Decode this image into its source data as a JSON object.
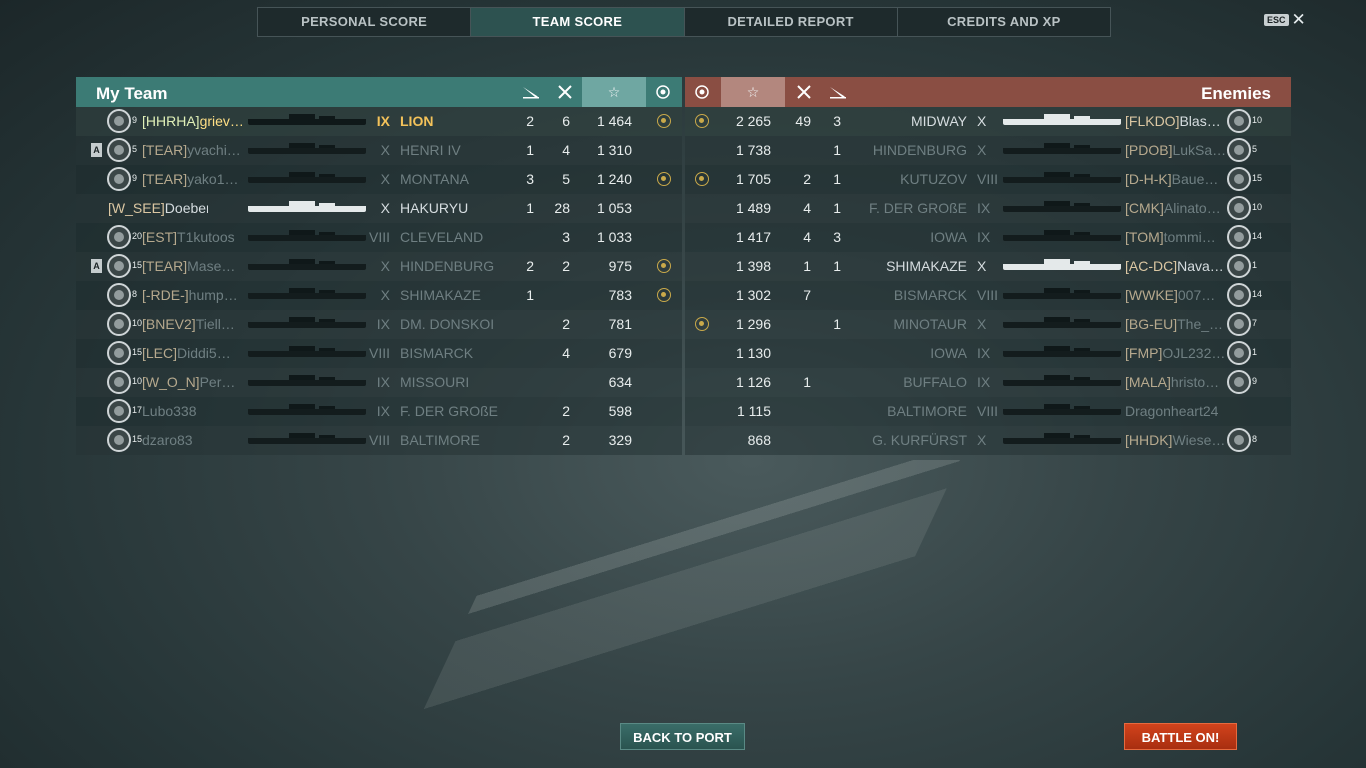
{
  "tabs": [
    "PERSONAL SCORE",
    "TEAM SCORE",
    "DETAILED REPORT",
    "CREDITS AND XP"
  ],
  "esc": {
    "key": "ESC",
    "close": "✕"
  },
  "my_team": {
    "title": "My Team",
    "headers": {
      "torpedo_icon": "torpedo-icon",
      "kills_icon": "crossed-swords-icon",
      "star": "☆",
      "medal_icon": "medal-icon"
    },
    "rows": [
      {
        "rank": "9",
        "clan": "[HHRHA]",
        "name": "griev…",
        "tier": "IX",
        "ship": "LION",
        "c1": "2",
        "c2": "6",
        "score": "1 464",
        "medal": true,
        "state": "me",
        "div": ""
      },
      {
        "rank": "5",
        "clan": "[TEAR]",
        "name": "yvachi…",
        "tier": "X",
        "ship": "HENRI IV",
        "c1": "1",
        "c2": "4",
        "score": "1 310",
        "medal": false,
        "state": "dead",
        "div": "A"
      },
      {
        "rank": "9",
        "clan": "[TEAR]",
        "name": "yako1…",
        "tier": "X",
        "ship": "MONTANA",
        "c1": "3",
        "c2": "5",
        "score": "1 240",
        "medal": true,
        "state": "dead",
        "div": ""
      },
      {
        "rank": "",
        "clan": "[W_SEE]",
        "name": "Doebernitz",
        "tier": "X",
        "ship": "HAKURYU",
        "c1": "1",
        "c2": "28",
        "score": "1 053",
        "medal": false,
        "state": "alive",
        "div": ""
      },
      {
        "rank": "20",
        "clan": "[EST]",
        "name": "T1kutoos",
        "tier": "VIII",
        "ship": "CLEVELAND",
        "c1": "",
        "c2": "3",
        "score": "1 033",
        "medal": false,
        "state": "dead",
        "div": ""
      },
      {
        "rank": "15",
        "clan": "[TEAR]",
        "name": "Mase…",
        "tier": "X",
        "ship": "HINDENBURG",
        "c1": "2",
        "c2": "2",
        "score": "975",
        "medal": true,
        "state": "dead",
        "div": "A"
      },
      {
        "rank": "8",
        "clan": "[-RDE-]",
        "name": "hump…",
        "tier": "X",
        "ship": "SHIMAKAZE",
        "c1": "1",
        "c2": "",
        "score": "783",
        "medal": true,
        "state": "dead",
        "div": ""
      },
      {
        "rank": "10",
        "clan": "[BNEV2]",
        "name": "Tiell…",
        "tier": "IX",
        "ship": "DM. DONSKOI",
        "c1": "",
        "c2": "2",
        "score": "781",
        "medal": false,
        "state": "dead",
        "div": ""
      },
      {
        "rank": "15",
        "clan": "[LEC]",
        "name": "Diddi5…",
        "tier": "VIII",
        "ship": "BISMARCK",
        "c1": "",
        "c2": "4",
        "score": "679",
        "medal": false,
        "state": "dead",
        "div": ""
      },
      {
        "rank": "10",
        "clan": "[W_O_N]",
        "name": "Per…",
        "tier": "IX",
        "ship": "MISSOURI",
        "c1": "",
        "c2": "",
        "score": "634",
        "medal": false,
        "state": "dead",
        "div": ""
      },
      {
        "rank": "17",
        "clan": "",
        "name": "Lubo338",
        "tier": "IX",
        "ship": "F. DER GROßE",
        "c1": "",
        "c2": "2",
        "score": "598",
        "medal": false,
        "state": "dead",
        "div": ""
      },
      {
        "rank": "15",
        "clan": "",
        "name": "dzaro83",
        "tier": "VIII",
        "ship": "BALTIMORE",
        "c1": "",
        "c2": "2",
        "score": "329",
        "medal": false,
        "state": "dead",
        "div": ""
      }
    ]
  },
  "enemies": {
    "title": "Enemies",
    "rows": [
      {
        "medal": true,
        "score": "2 265",
        "c2": "49",
        "c1": "3",
        "ship": "MIDWAY",
        "tier": "X",
        "clan": "[FLKDO]",
        "name": "Blas…",
        "rank": "10",
        "state": "alive",
        "white": true
      },
      {
        "medal": false,
        "score": "1 738",
        "c2": "",
        "c1": "1",
        "ship": "HINDENBURG",
        "tier": "X",
        "clan": "[PDOB]",
        "name": "LukSa…",
        "rank": "5",
        "state": "dead",
        "white": false
      },
      {
        "medal": true,
        "score": "1 705",
        "c2": "2",
        "c1": "1",
        "ship": "KUTUZOV",
        "tier": "VIII",
        "clan": "[D-H-K]",
        "name": "Baue…",
        "rank": "15",
        "state": "dead",
        "white": false
      },
      {
        "medal": false,
        "score": "1 489",
        "c2": "4",
        "c1": "1",
        "ship": "F. DER GROßE",
        "tier": "IX",
        "clan": "[CMK]",
        "name": "Alinato…",
        "rank": "10",
        "state": "dead",
        "white": false
      },
      {
        "medal": false,
        "score": "1 417",
        "c2": "4",
        "c1": "3",
        "ship": "IOWA",
        "tier": "IX",
        "clan": "[TOM]",
        "name": "tommi…",
        "rank": "14",
        "state": "dead",
        "white": false
      },
      {
        "medal": false,
        "score": "1 398",
        "c2": "1",
        "c1": "1",
        "ship": "SHIMAKAZE",
        "tier": "X",
        "clan": "[AC-DC]",
        "name": "Nava…",
        "rank": "1",
        "state": "alive",
        "white": true
      },
      {
        "medal": false,
        "score": "1 302",
        "c2": "7",
        "c1": "",
        "ship": "BISMARCK",
        "tier": "VIII",
        "clan": "[WWKE]",
        "name": "007…",
        "rank": "14",
        "state": "dead",
        "white": false
      },
      {
        "medal": true,
        "score": "1 296",
        "c2": "",
        "c1": "1",
        "ship": "MINOTAUR",
        "tier": "X",
        "clan": "[BG-EU]",
        "name": "The_…",
        "rank": "7",
        "state": "dead",
        "white": false
      },
      {
        "medal": false,
        "score": "1 130",
        "c2": "",
        "c1": "",
        "ship": "IOWA",
        "tier": "IX",
        "clan": "[FMP]",
        "name": "OJL232…",
        "rank": "1",
        "state": "dead",
        "white": false
      },
      {
        "medal": false,
        "score": "1 126",
        "c2": "1",
        "c1": "",
        "ship": "BUFFALO",
        "tier": "IX",
        "clan": "[MALA]",
        "name": "hristo…",
        "rank": "9",
        "state": "dead",
        "white": false
      },
      {
        "medal": false,
        "score": "1 115",
        "c2": "",
        "c1": "",
        "ship": "BALTIMORE",
        "tier": "VIII",
        "clan": "",
        "name": "Dragonheart24",
        "rank": "",
        "state": "dead",
        "white": false
      },
      {
        "medal": false,
        "score": "868",
        "c2": "",
        "c1": "",
        "ship": "G. KURFÜRST",
        "tier": "X",
        "clan": "[HHDK]",
        "name": "Wiese…",
        "rank": "8",
        "state": "dead",
        "white": false
      }
    ]
  },
  "buttons": {
    "back": "BACK TO PORT",
    "battle": "BATTLE ON!"
  },
  "colors": {
    "team_header": "#3c7b75",
    "enemy_header": "#8a4e43",
    "battle_button": "#c83a18",
    "active_tab": "#2d5250"
  }
}
